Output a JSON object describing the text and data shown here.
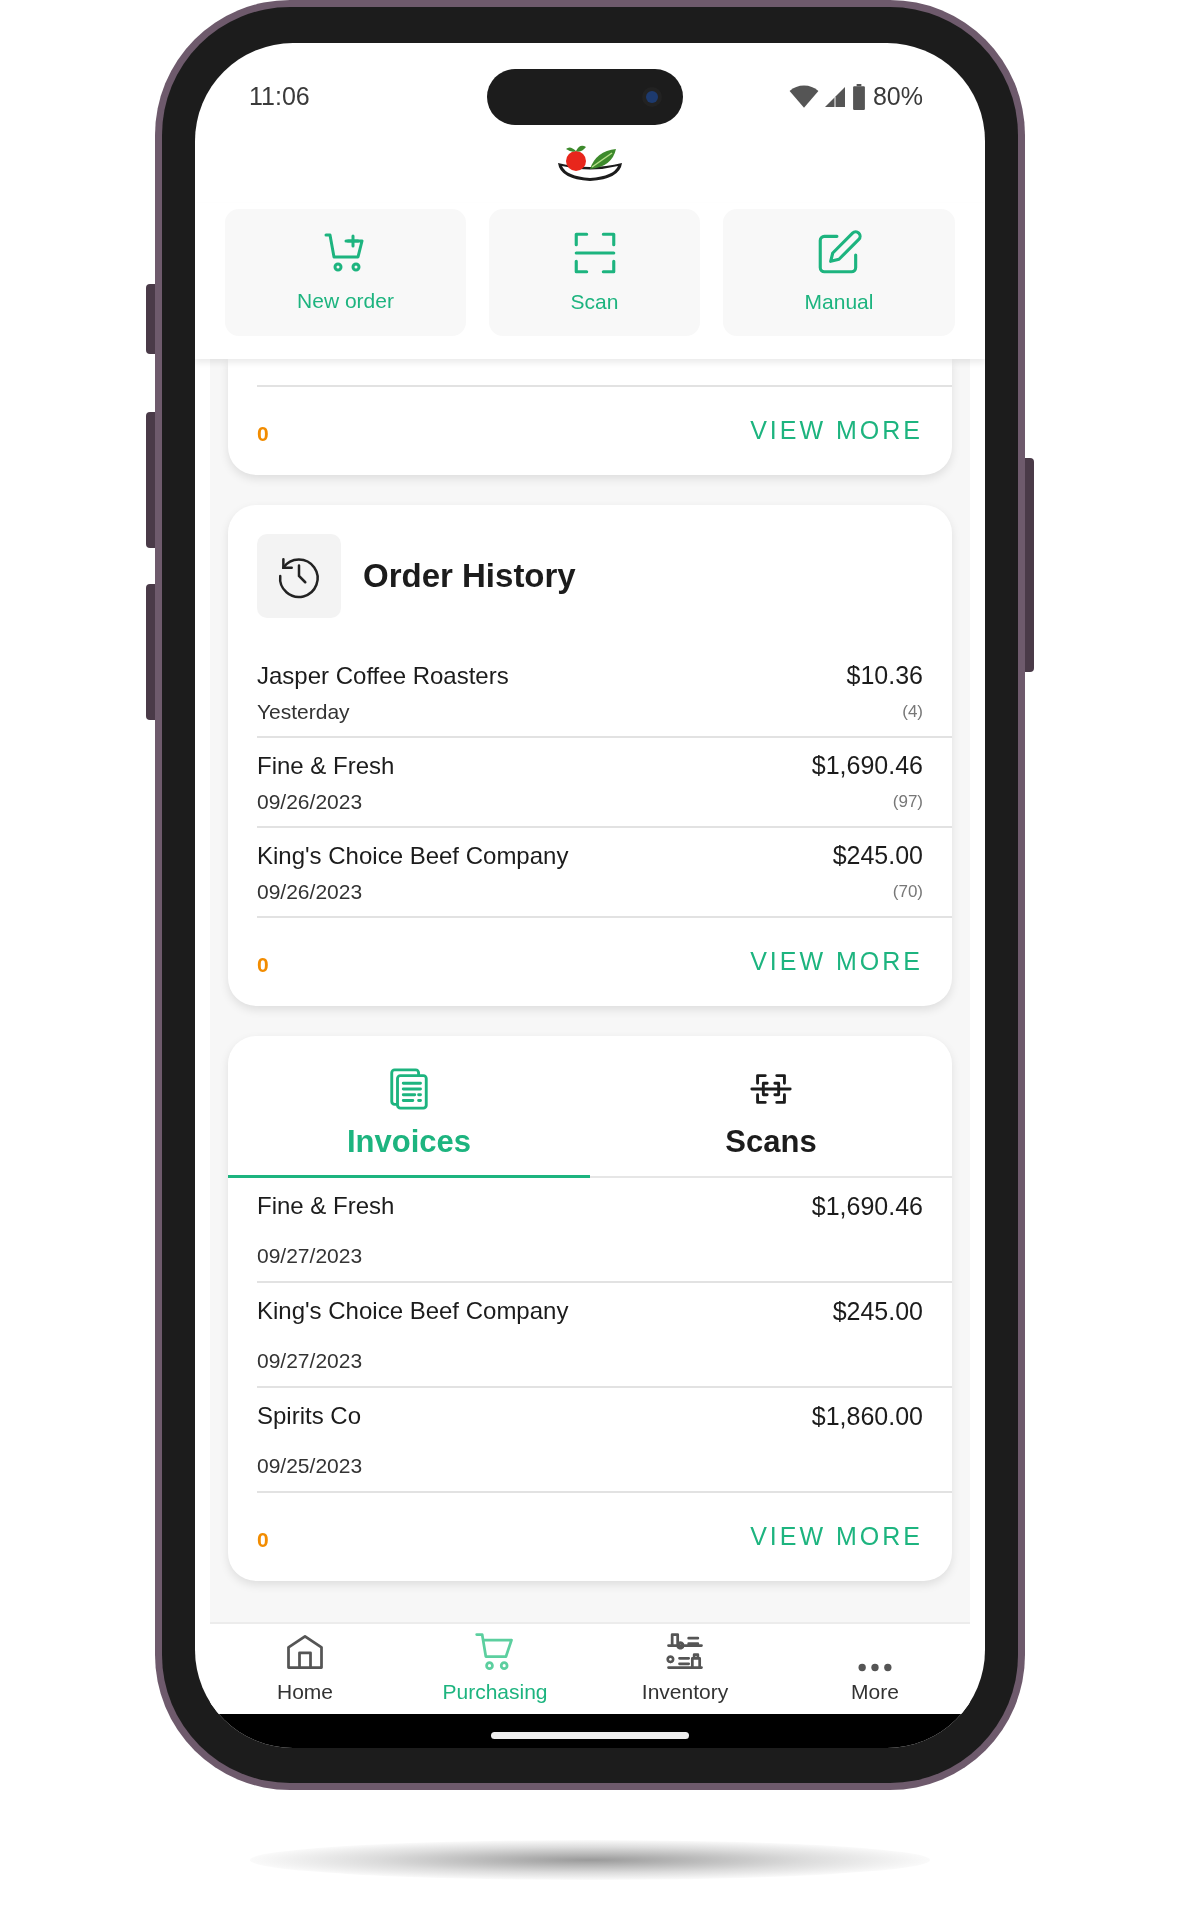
{
  "status_bar": {
    "time": "11:06",
    "battery": "80%"
  },
  "quick_actions": [
    {
      "label": "New order",
      "kind": "cart-plus"
    },
    {
      "label": "Scan",
      "kind": "scan"
    },
    {
      "label": "Manual",
      "kind": "edit"
    }
  ],
  "previous_card": {
    "count": "0",
    "link": "VIEW MORE"
  },
  "order_history": {
    "title": "Order History",
    "rows": [
      {
        "name": "Jasper Coffee Roasters",
        "date": "Yesterday",
        "amount": "$10.36",
        "count": "(4)"
      },
      {
        "name": "Fine & Fresh",
        "date": "09/26/2023",
        "amount": "$1,690.46",
        "count": "(97)"
      },
      {
        "name": "King's Choice Beef Company",
        "date": "09/26/2023",
        "amount": "$245.00",
        "count": "(70)"
      }
    ],
    "count": "0",
    "link": "VIEW MORE"
  },
  "documents": {
    "tabs": [
      {
        "label": "Invoices",
        "kind": "invoice",
        "selected": true
      },
      {
        "label": "Scans",
        "kind": "scan",
        "selected": false
      }
    ],
    "rows": [
      {
        "name": "Fine & Fresh",
        "date": "09/27/2023",
        "amount": "$1,690.46"
      },
      {
        "name": "King's Choice Beef Company",
        "date": "09/27/2023",
        "amount": "$245.00"
      },
      {
        "name": "Spirits Co",
        "date": "09/25/2023",
        "amount": "$1,860.00"
      }
    ],
    "count": "0",
    "link": "VIEW MORE"
  },
  "bottom_nav": [
    {
      "label": "Home",
      "kind": "home",
      "selected": false
    },
    {
      "label": "Purchasing",
      "kind": "cart",
      "selected": true
    },
    {
      "label": "Inventory",
      "kind": "inventory",
      "selected": false
    },
    {
      "label": "More",
      "kind": "more",
      "selected": false
    }
  ]
}
